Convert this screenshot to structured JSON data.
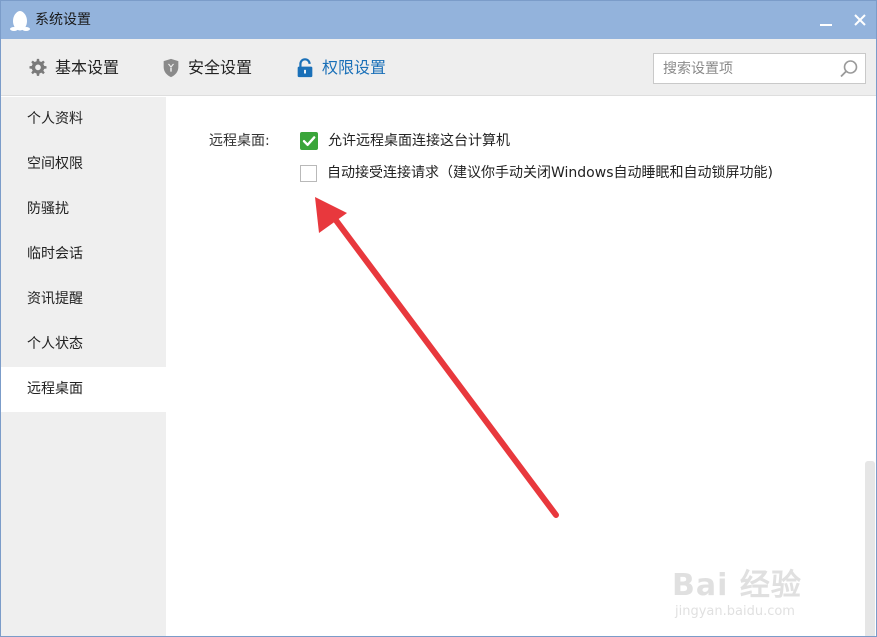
{
  "window": {
    "title": "系统设置",
    "minimize_icon": "minimize-icon",
    "close_icon": "close-icon"
  },
  "tabs": [
    {
      "label": "基本设置",
      "icon": "gear-icon",
      "active": false
    },
    {
      "label": "安全设置",
      "icon": "shield-icon",
      "active": false
    },
    {
      "label": "权限设置",
      "icon": "lock-icon",
      "active": true
    }
  ],
  "search": {
    "placeholder": "搜索设置项",
    "value": ""
  },
  "sidebar": {
    "items": [
      {
        "label": "个人资料"
      },
      {
        "label": "空间权限"
      },
      {
        "label": "防骚扰"
      },
      {
        "label": "临时会话"
      },
      {
        "label": "资讯提醒"
      },
      {
        "label": "个人状态"
      },
      {
        "label": "远程桌面",
        "active": true
      }
    ]
  },
  "content": {
    "section_label": "远程桌面:",
    "options": [
      {
        "label": "允许远程桌面连接这台计算机",
        "checked": true
      },
      {
        "label": "自动接受连接请求（建议你手动关闭Windows自动睡眠和自动锁屏功能)",
        "checked": false
      }
    ]
  },
  "colors": {
    "titlebar": "#93b3dc",
    "active_tab": "#1a70b8",
    "check_green": "#3aa53a",
    "annotation_arrow": "#e8383d"
  },
  "watermark": {
    "main": "Bai 经验",
    "sub": "jingyan.baidu.com"
  }
}
